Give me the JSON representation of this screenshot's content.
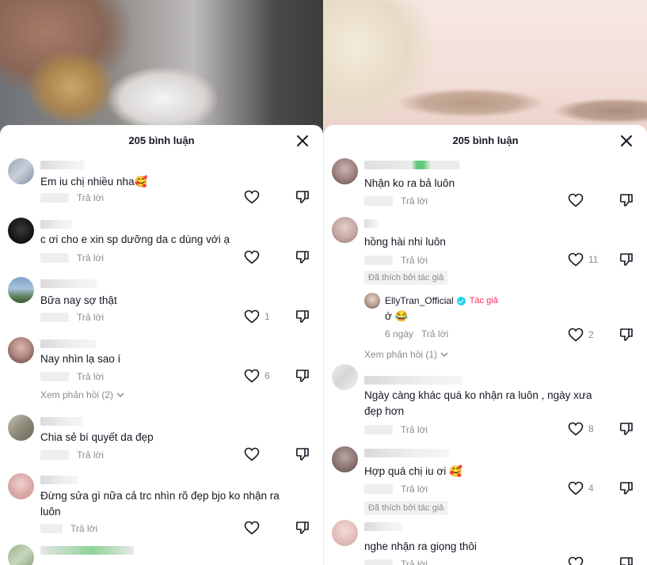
{
  "left_panel": {
    "title": "205 bình luận",
    "comments": [
      {
        "text": "Em iu chị nhiều nha🥰",
        "reply": "Trả lời",
        "likes": ""
      },
      {
        "text": "c ơi cho e xin sp dưỡng da c dùng với ạ",
        "reply": "Trả lời",
        "likes": ""
      },
      {
        "text": "Bữa nay sợ thật",
        "reply": "Trả lời",
        "likes": "1"
      },
      {
        "text": "Nay nhìn lạ sao í",
        "reply": "Trả lời",
        "likes": "6",
        "view_replies": "Xem phản hồi (2)"
      },
      {
        "text": "Chia sẻ bí quyết da đẹp",
        "reply": "Trả lời",
        "likes": ""
      },
      {
        "text": "Đừng sửa gì nữa cả trc nhìn rõ đẹp bjo ko nhận ra luôn",
        "reply": "Trả lời",
        "likes": ""
      }
    ]
  },
  "right_panel": {
    "title": "205 bình luận",
    "comments": [
      {
        "text": "Nhận ko ra bả luôn",
        "reply": "Trả lời",
        "likes": ""
      },
      {
        "text": "hồng hài nhi luôn",
        "reply": "Trả lời",
        "likes": "11",
        "author_liked": "Đã thích bởi tác giả"
      },
      {
        "text": "Ngày càng khác quá ko nhận ra luôn , ngày xưa đẹp hơn",
        "reply": "Trả lời",
        "likes": "8"
      },
      {
        "text": "Hợp quá chị iu ơi 🥰",
        "reply": "Trả lời",
        "likes": "4",
        "author_liked": "Đã thích bởi tác giả"
      },
      {
        "text": "nghe nhận ra giọng thôi",
        "reply": "Trả lời",
        "likes": ""
      }
    ],
    "author_reply": {
      "name": "EllyTran_Official",
      "tag": "Tác giả",
      "text": "ớ 😂",
      "date": "6 ngày",
      "reply": "Trả lời",
      "likes": "2",
      "view_replies": "Xem phản hồi (1)"
    }
  },
  "colors": {
    "accent": "#fe2c55",
    "verified": "#20d5ec",
    "muted": "#8a8b91",
    "text": "#161823"
  },
  "icons": [
    "close-icon",
    "heart-icon",
    "dislike-icon",
    "chevron-down-icon",
    "verified-icon"
  ]
}
